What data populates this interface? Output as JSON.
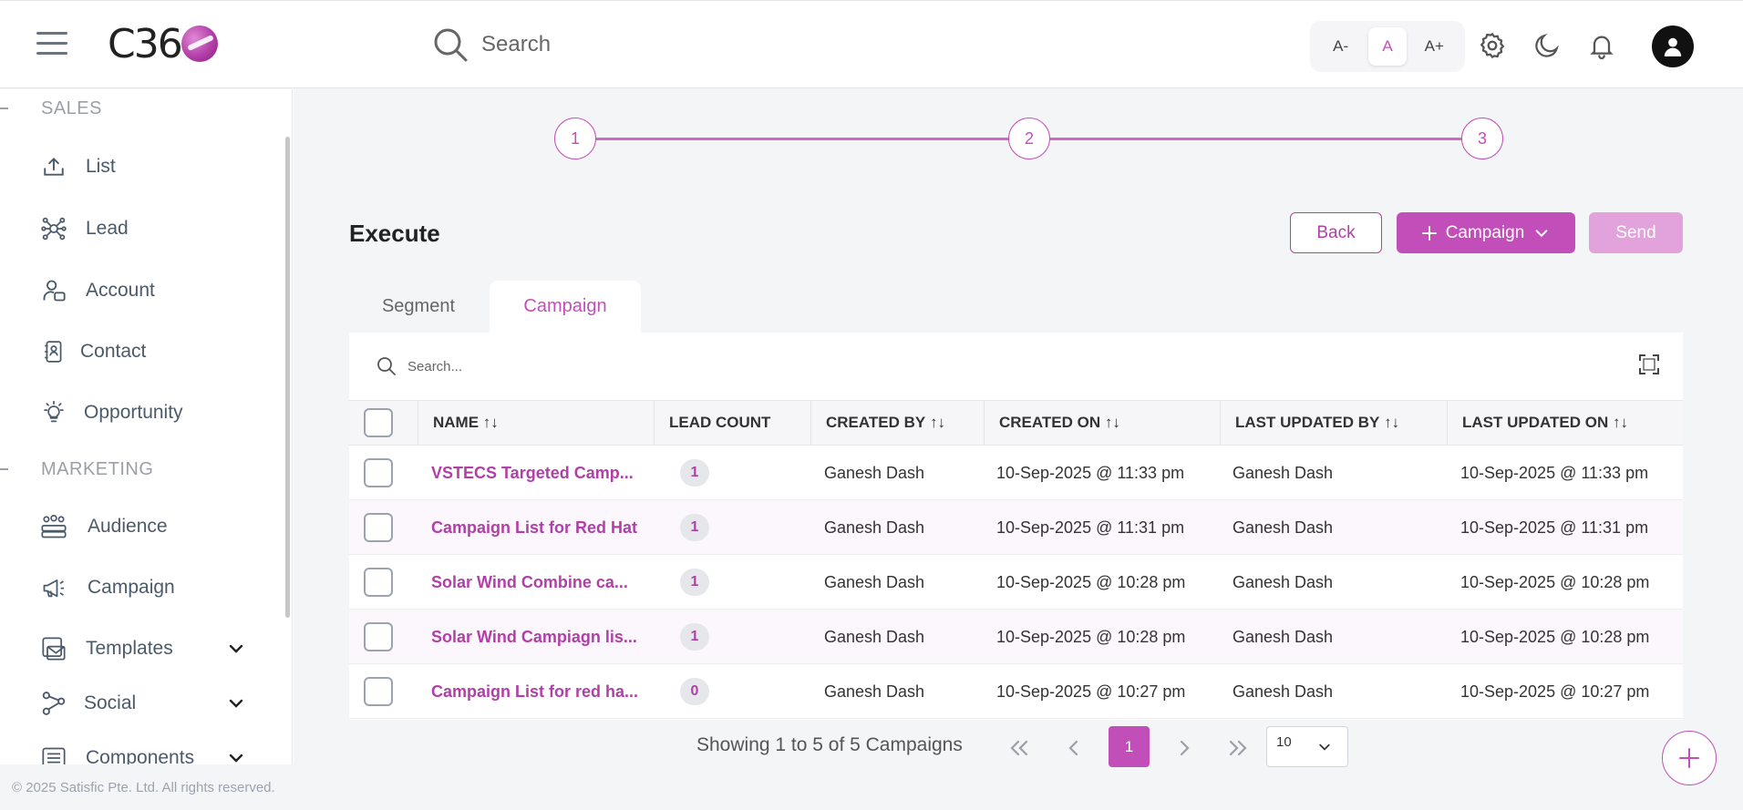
{
  "header": {
    "logo_text": "C36",
    "search_placeholder": "Search",
    "font_size_buttons": [
      "A-",
      "A",
      "A+"
    ],
    "active_font_size": "A"
  },
  "sidebar": {
    "sections": [
      {
        "title": "SALES",
        "items": [
          {
            "label": "List",
            "icon": "upload-icon"
          },
          {
            "label": "Lead",
            "icon": "network-icon"
          },
          {
            "label": "Account",
            "icon": "user-card-icon"
          },
          {
            "label": "Contact",
            "icon": "contact-book-icon"
          },
          {
            "label": "Opportunity",
            "icon": "lightbulb-icon"
          }
        ]
      },
      {
        "title": "MARKETING",
        "items": [
          {
            "label": "Audience",
            "icon": "audience-icon"
          },
          {
            "label": "Campaign",
            "icon": "megaphone-icon"
          },
          {
            "label": "Templates",
            "icon": "templates-icon",
            "expandable": true
          },
          {
            "label": "Social",
            "icon": "share-nodes-icon",
            "expandable": true
          },
          {
            "label": "Components",
            "icon": "components-icon",
            "expandable": true
          }
        ]
      }
    ],
    "footer": "© 2025 Satisfic Pte. Ltd. All rights reserved."
  },
  "stepper": {
    "steps": [
      "1",
      "2",
      "3"
    ]
  },
  "page": {
    "title": "Execute",
    "back_label": "Back",
    "campaign_label": "Campaign",
    "send_label": "Send"
  },
  "tabs": [
    {
      "label": "Segment",
      "active": false
    },
    {
      "label": "Campaign",
      "active": true
    }
  ],
  "table": {
    "search_placeholder": "Search...",
    "columns": [
      "NAME",
      "LEAD COUNT",
      "CREATED BY",
      "CREATED ON",
      "LAST UPDATED BY",
      "LAST UPDATED ON"
    ],
    "rows": [
      {
        "name": "VSTECS Targeted Camp...",
        "lead_count": "1",
        "created_by": "Ganesh Dash",
        "created_on": "10-Sep-2025 @ 11:33 pm",
        "updated_by": "Ganesh Dash",
        "updated_on": "10-Sep-2025 @ 11:33 pm"
      },
      {
        "name": "Campaign List for Red Hat",
        "lead_count": "1",
        "created_by": "Ganesh Dash",
        "created_on": "10-Sep-2025 @ 11:31 pm",
        "updated_by": "Ganesh Dash",
        "updated_on": "10-Sep-2025 @ 11:31 pm"
      },
      {
        "name": "Solar Wind Combine ca...",
        "lead_count": "1",
        "created_by": "Ganesh Dash",
        "created_on": "10-Sep-2025 @ 10:28 pm",
        "updated_by": "Ganesh Dash",
        "updated_on": "10-Sep-2025 @ 10:28 pm"
      },
      {
        "name": "Solar Wind Campiagn lis...",
        "lead_count": "1",
        "created_by": "Ganesh Dash",
        "created_on": "10-Sep-2025 @ 10:28 pm",
        "updated_by": "Ganesh Dash",
        "updated_on": "10-Sep-2025 @ 10:28 pm"
      },
      {
        "name": "Campaign List for red ha...",
        "lead_count": "0",
        "created_by": "Ganesh Dash",
        "created_on": "10-Sep-2025 @ 10:27 pm",
        "updated_by": "Ganesh Dash",
        "updated_on": "10-Sep-2025 @ 10:27 pm"
      }
    ]
  },
  "pagination": {
    "info": "Showing 1 to 5 of 5 Campaigns",
    "current_page": "1",
    "page_size": "10"
  },
  "colors": {
    "accent": "#c24fb9",
    "accent_light": "#e2a3dd",
    "text_muted": "#4b5a6b"
  }
}
